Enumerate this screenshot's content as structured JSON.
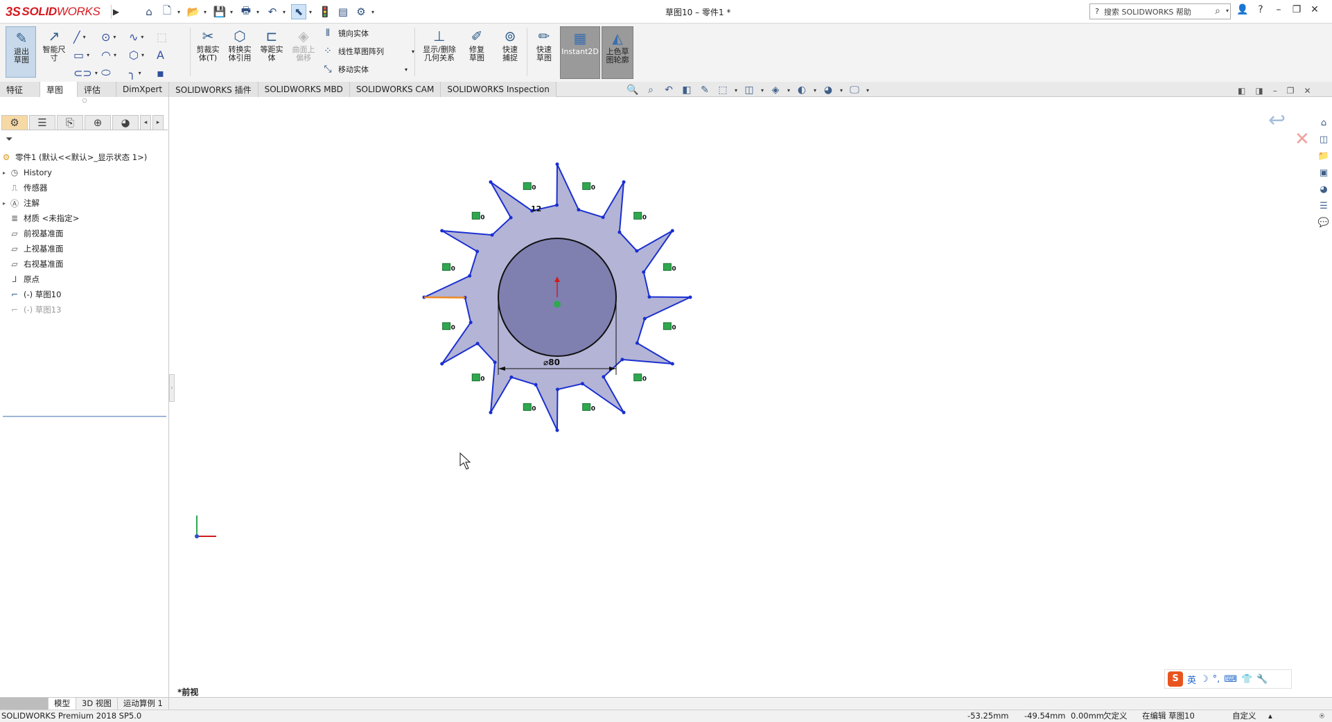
{
  "app": {
    "brand_ds": "3S",
    "brand_solid": "SOLID",
    "brand_works": "WORKS",
    "document_title": "草图10 – 零件1 *"
  },
  "search": {
    "placeholder": "搜索 SOLIDWORKS 帮助"
  },
  "ribbon": {
    "exit_sketch": "退出草图",
    "smart_dimension": "智能尺寸",
    "trim": "剪裁实体(T)",
    "convert": "转换实体引用",
    "offset": "等距实体",
    "surface_offset": "曲面上偏移",
    "mirror": "镜向实体",
    "linear_pattern": "线性草图阵列",
    "move": "移动实体",
    "relations": "显示/删除几何关系",
    "repair": "修复草图",
    "quick_snap": "快速捕捉",
    "rapid_sketch": "快速草图",
    "instant2d": "Instant2D",
    "shaded_sketch": "上色草图轮廓"
  },
  "tabs": [
    "特征",
    "草图",
    "评估",
    "DimXpert",
    "SOLIDWORKS 插件",
    "SOLIDWORKS MBD",
    "SOLIDWORKS CAM",
    "SOLIDWORKS Inspection"
  ],
  "active_tab": "草图",
  "tree": {
    "root": "零件1 (默认<<默认>_显示状态 1>)",
    "items": [
      {
        "label": "History",
        "icon": "history-icon"
      },
      {
        "label": "传感器",
        "icon": "sensor-icon"
      },
      {
        "label": "注解",
        "icon": "annotation-icon"
      },
      {
        "label": "材质 <未指定>",
        "icon": "material-icon"
      },
      {
        "label": "前视基准面",
        "icon": "plane-icon"
      },
      {
        "label": "上视基准面",
        "icon": "plane-icon"
      },
      {
        "label": "右视基准面",
        "icon": "plane-icon"
      },
      {
        "label": "原点",
        "icon": "origin-icon"
      },
      {
        "label": "(-) 草图10",
        "icon": "sketch-icon"
      },
      {
        "label": "(-) 草图13",
        "icon": "sketch-icon"
      }
    ]
  },
  "sketch": {
    "pattern_count": "12",
    "diameter_label": "⌀80",
    "relation_label": "0",
    "colors": {
      "fill": "#b3b4d6",
      "circle_fill": "#7f7fb0",
      "edge": "#1a2fd0",
      "highlight": "#f08a24"
    }
  },
  "view_label": "*前视",
  "bottom_tabs": [
    "模型",
    "3D 视图",
    "运动算例 1"
  ],
  "status": {
    "version": "SOLIDWORKS Premium 2018 SP5.0",
    "x": "-53.25mm",
    "y": "-49.54mm",
    "z": "0.00mm",
    "state": "欠定义",
    "editing": "在编辑 草图10",
    "units": "自定义"
  },
  "ime": {
    "lang": "英"
  }
}
